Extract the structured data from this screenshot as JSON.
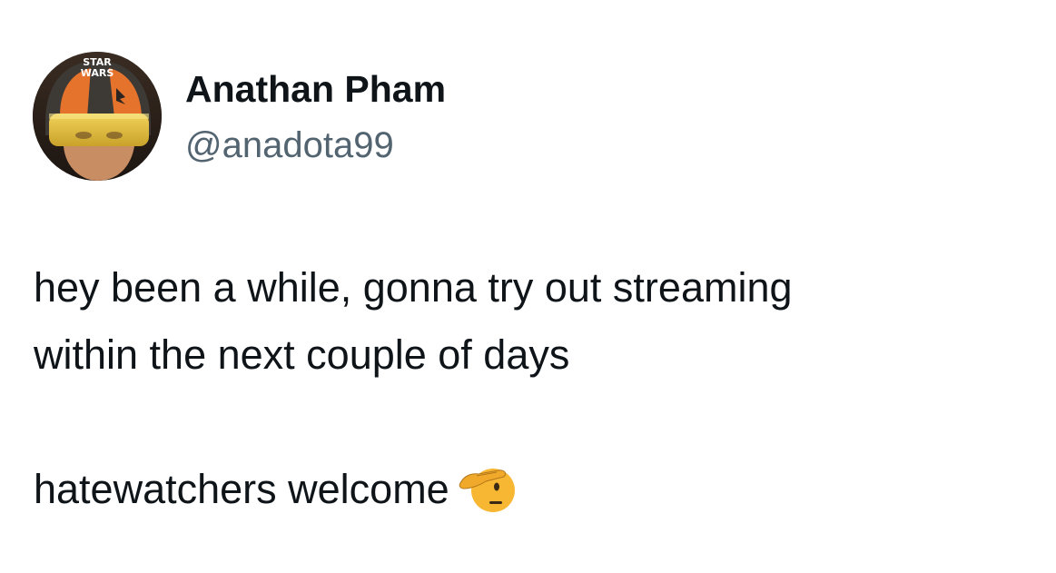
{
  "tweet": {
    "author": {
      "name": "Anathan Pham",
      "handle": "@anadota99",
      "avatar_icon": "star-wars-pilot-avatar",
      "avatar_logo_text": "STAR WARS"
    },
    "text": {
      "line1": "hey been a while, gonna try out streaming",
      "line2": "within the next couple of days",
      "line3": "hatewatchers welcome",
      "emoji_icon": "saluting-face-icon"
    }
  },
  "colors": {
    "text_primary": "#0f1419",
    "text_secondary": "#536471",
    "background": "#ffffff",
    "emoji_yellow": "#f7b733"
  }
}
